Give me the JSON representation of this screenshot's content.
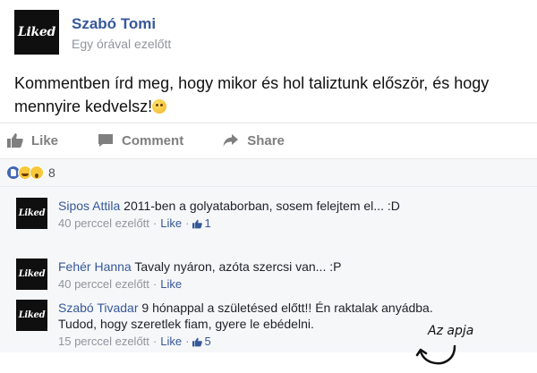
{
  "post": {
    "logo_text": "Liked",
    "author": "Szabó Tomi",
    "time": "Egy órával ezelőtt",
    "text": "Kommentben írd meg, hogy mikor és hol taliztunk először, és hogy mennyire kedvelsz!"
  },
  "actions": {
    "like": "Like",
    "comment": "Comment",
    "share": "Share"
  },
  "reactions": {
    "icons": [
      "like-reaction-icon",
      "haha-reaction-icon",
      "wow-reaction-icon"
    ],
    "count": "8"
  },
  "comments": [
    {
      "logo_text": "Liked",
      "name": "Sipos Attila",
      "text": " 2011-ben a golyataborban, sosem felejtem el... :D",
      "time": "40 perccel ezelőtt",
      "like_label": "Like",
      "likes": "1"
    },
    {
      "logo_text": "Liked",
      "name": "Fehér Hanna",
      "text": " Tavaly nyáron, azóta szercsi van... :P",
      "time": "40 perccel ezelőtt",
      "like_label": "Like",
      "likes": ""
    },
    {
      "logo_text": "Liked",
      "name": "Szabó Tivadar",
      "text": " 9 hónappal a születésed előtt!! Én raktalak anyádba. Tudod, hogy szeretlek fiam, gyere le ebédelni.",
      "time": "15 perccel ezelőtt",
      "like_label": "Like",
      "likes": "5"
    }
  ],
  "annotation": "Az apja",
  "colors": {
    "link_blue": "#365899",
    "muted_gray": "#90949c",
    "comment_bg": "#f6f7f9"
  }
}
